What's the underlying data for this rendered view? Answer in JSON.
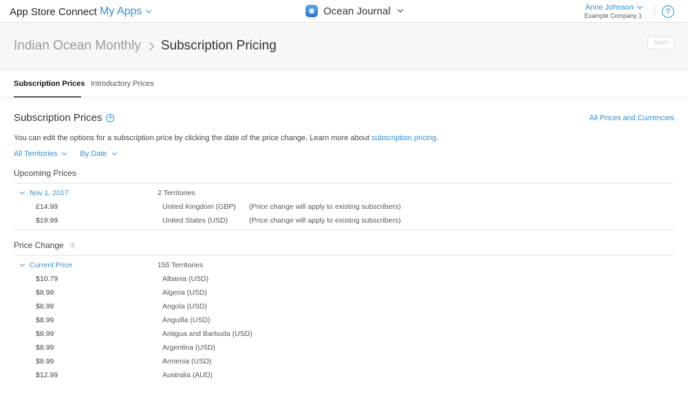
{
  "topnav": {
    "brand": "App Store Connect",
    "my_apps": "My Apps",
    "app_name": "Ocean Journal",
    "user_name": "Anne Johnson",
    "user_company": "Example Company 1",
    "help_symbol": "?"
  },
  "header": {
    "parent": "Indian Ocean Monthly",
    "current": "Subscription Pricing",
    "save_label": "Save"
  },
  "tabs": [
    {
      "label": "Subscription Prices",
      "active": true
    },
    {
      "label": "Introductory Prices",
      "active": false
    }
  ],
  "content": {
    "section_title": "Subscription Prices",
    "all_prices_link": "All Prices and Currencies",
    "description": "You can edit the options for a subscription price by clicking the date of the price change. Learn more about",
    "description_link": "subscription pricing",
    "description_end": ".",
    "filters": [
      "All Territories",
      "By Date"
    ]
  },
  "upcoming": {
    "title": "Upcoming Prices",
    "date": "Nov 1, 2017",
    "territories": "2 Territories",
    "rows": [
      {
        "price": "£14.99",
        "country": "United Kingdom (GBP)",
        "note": "(Price change will apply to existing subscribers)"
      },
      {
        "price": "$19.99",
        "country": "United States (USD)",
        "note": "(Price change will apply to existing subscribers)"
      }
    ]
  },
  "price_change": {
    "title": "Price Change",
    "help_symbol": "?",
    "label": "Current Price",
    "territories": "155 Territories",
    "rows": [
      {
        "price": "$10.79",
        "country": "Albania (USD)"
      },
      {
        "price": "$8.99",
        "country": "Algeria (USD)"
      },
      {
        "price": "$8.99",
        "country": "Angola (USD)"
      },
      {
        "price": "$8.99",
        "country": "Anguilla (USD)"
      },
      {
        "price": "$8.99",
        "country": "Antigua and Barbuda (USD)"
      },
      {
        "price": "$8.99",
        "country": "Argentina (USD)"
      },
      {
        "price": "$8.99",
        "country": "Armenia (USD)"
      },
      {
        "price": "$12.99",
        "country": "Australia (AUD)"
      }
    ]
  },
  "colors": {
    "accent": "#2d8fd5",
    "header_bg": "#f7f7f7"
  }
}
